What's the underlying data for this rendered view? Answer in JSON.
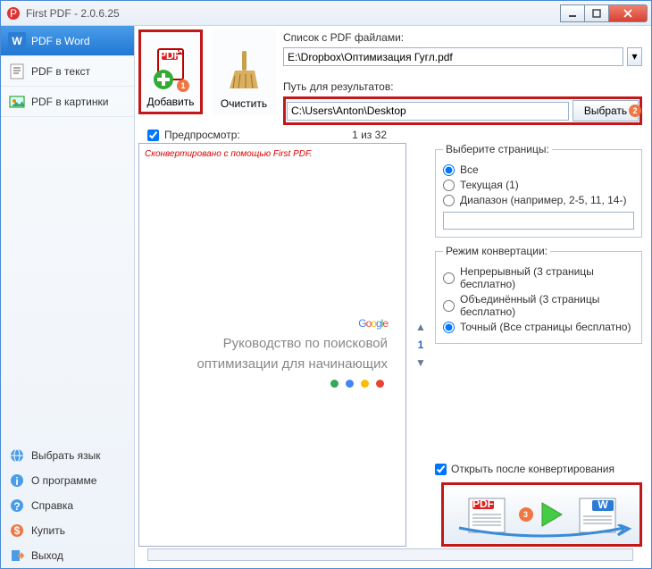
{
  "window": {
    "title": "First PDF - 2.0.6.25"
  },
  "sidebar": {
    "items": [
      {
        "label": "PDF в Word",
        "active": true
      },
      {
        "label": "PDF в текст"
      },
      {
        "label": "PDF в картинки"
      }
    ],
    "bottom": [
      {
        "label": "Выбрать язык"
      },
      {
        "label": "О программе"
      },
      {
        "label": "Справка"
      },
      {
        "label": "Купить"
      },
      {
        "label": "Выход"
      }
    ]
  },
  "toolbar": {
    "add": "Добавить",
    "clear": "Очистить"
  },
  "paths": {
    "list_label": "Список с PDF файлами:",
    "list_value": "E:\\Dropbox\\Оптимизация Гугл.pdf",
    "result_label": "Путь для результатов:",
    "result_value": "C:\\Users\\Anton\\Desktop",
    "browse": "Выбрать"
  },
  "preview": {
    "checkbox": "Предпросмотр:",
    "page_text": "1 из 32",
    "note": "Сконвертировано с помощью First PDF.",
    "logo": "Google",
    "line1": "Руководство по поисковой",
    "line2": "оптимизации для начинающих",
    "page_num": "1"
  },
  "pages_group": {
    "legend": "Выберите страницы:",
    "all": "Все",
    "current": "Текущая (1)",
    "range": "Диапазон (например, 2-5, 11, 14-)"
  },
  "mode_group": {
    "legend": "Режим конвертации:",
    "cont": "Непрерывный (3 страницы бесплатно)",
    "joined": "Объединённый (3 страницы бесплатно)",
    "exact": "Точный (Все страницы бесплатно)"
  },
  "open_after": "Открыть после конвертирования",
  "badges": {
    "n1": "1",
    "n2": "2",
    "n3": "3"
  },
  "colors": {
    "accent": "#2178d4",
    "highlight": "#c21818"
  }
}
